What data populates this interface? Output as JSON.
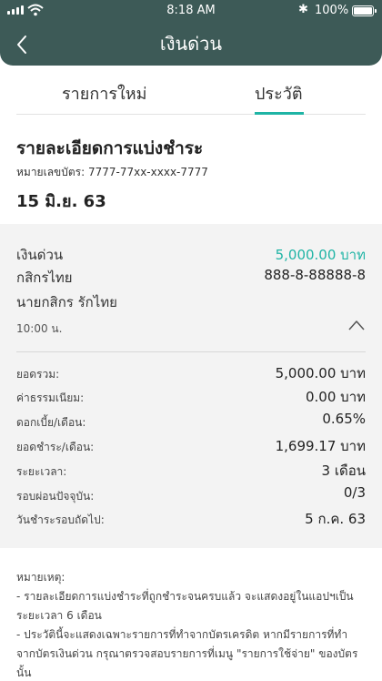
{
  "status_bar": {
    "time": "8:18 AM",
    "battery": "100%"
  },
  "header": {
    "title": "เงินด่วน"
  },
  "tabs": {
    "new": "รายการใหม่",
    "history": "ประวัติ"
  },
  "section": {
    "title": "รายละเอียดการแบ่งชำระ",
    "card_number": "หมายเลขบัตร: 7777-77xx-xxxx-7777",
    "date": "15 มิ.ย. 63"
  },
  "transaction": {
    "type": "เงินด่วน",
    "amount": "5,000.00 บาท",
    "bank": "กสิกรไทย",
    "account_no": "888-8-88888-8",
    "account_name": "นายกสิกร รักไทย",
    "time": "10:00 น."
  },
  "summary": [
    {
      "label": "ยอดรวม:",
      "value": "5,000.00 บาท"
    },
    {
      "label": "ค่าธรรมเนียม:",
      "value": "0.00 บาท"
    },
    {
      "label": "ดอกเบี้ย/เดือน:",
      "value": "0.65%"
    },
    {
      "label": "ยอดชำระ/เดือน:",
      "value": "1,699.17 บาท"
    },
    {
      "label": "ระยะเวลา:",
      "value": "3 เดือน"
    },
    {
      "label": "รอบผ่อนปัจจุบัน:",
      "value": "0/3"
    },
    {
      "label": "วันชำระรอบถัดไป:",
      "value": "5 ก.ค. 63"
    }
  ],
  "notes": {
    "heading": "หมายเหตุ:",
    "line1": "- รายละเอียดการแบ่งชำระที่ถูกชำระจนครบแล้ว จะแสดงอยู่ในแอปฯเป็นระยะเวลา 6 เดือน",
    "line2": "- ประวัตินี้จะแสดงเฉพาะรายการที่ทำจากบัตรเครดิต หากมีรายการที่ทำจากบัตรเงินด่วน กรุณาตรวจสอบรายการที่เมนู \"รายการใช้จ่าย\" ของบัตรนั้น"
  },
  "colors": {
    "header": "#3d5a57",
    "accent": "#1fb4a5",
    "detail_bg": "#f3f3f3"
  }
}
